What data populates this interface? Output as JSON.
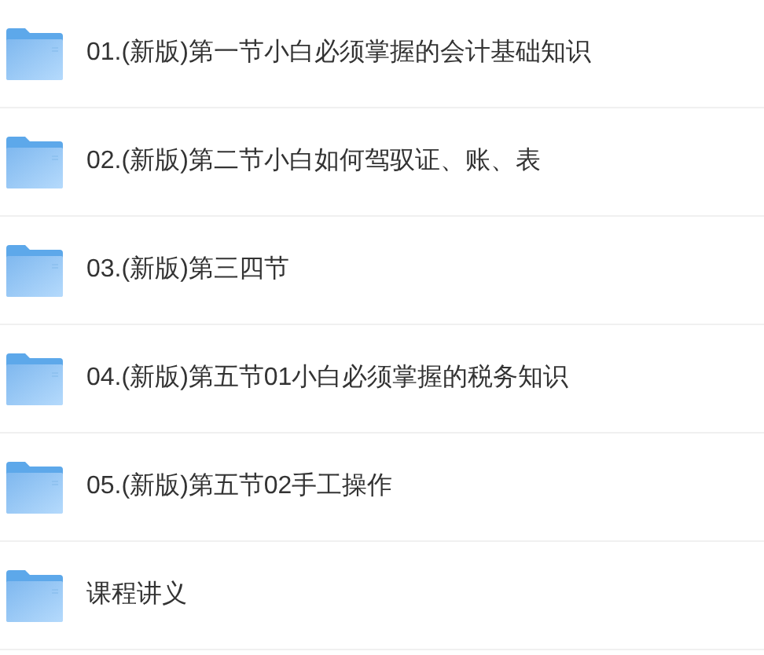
{
  "folders": [
    {
      "name": "01.(新版)第一节小白必须掌握的会计基础知识"
    },
    {
      "name": "02.(新版)第二节小白如何驾驭证、账、表"
    },
    {
      "name": "03.(新版)第三四节"
    },
    {
      "name": "04.(新版)第五节01小白必须掌握的税务知识"
    },
    {
      "name": "05.(新版)第五节02手工操作"
    },
    {
      "name": "课程讲义"
    }
  ]
}
